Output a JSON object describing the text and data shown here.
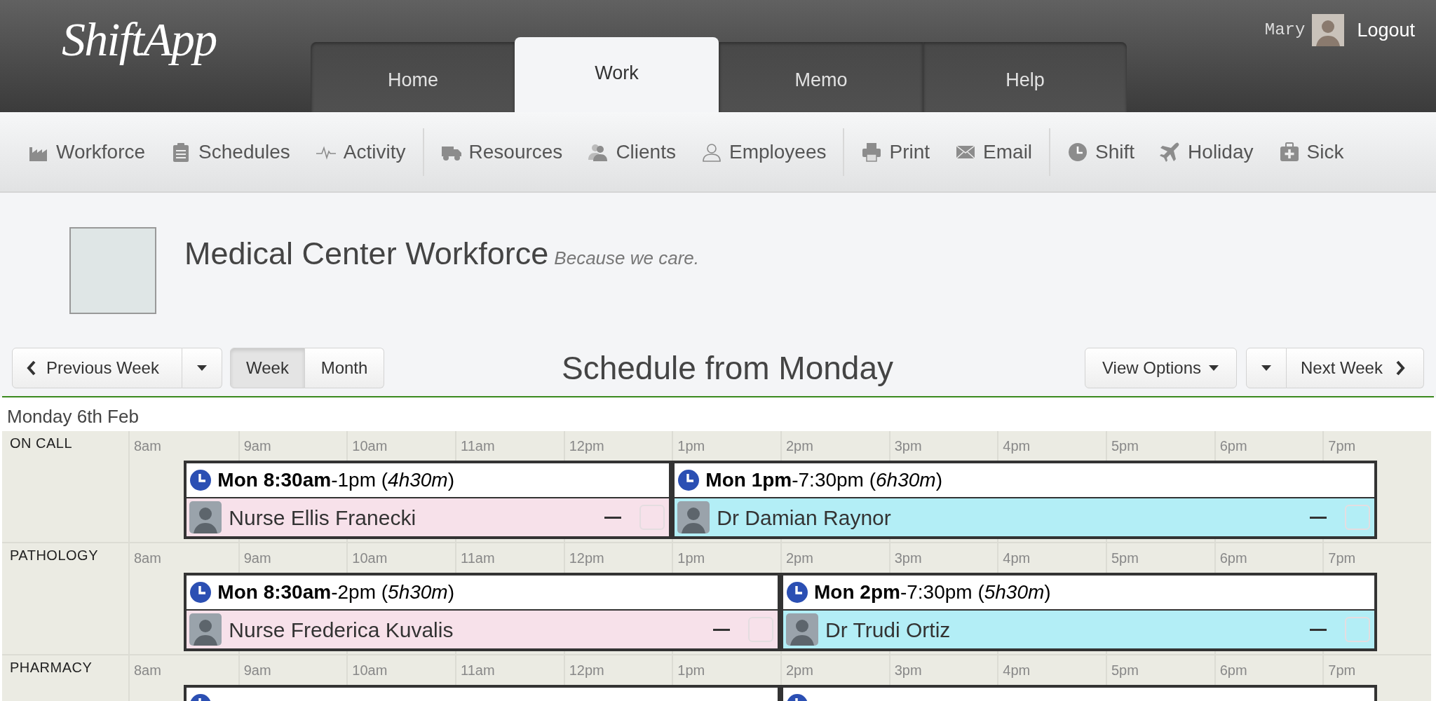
{
  "app": {
    "logo": "ShiftApp"
  },
  "nav_tabs": [
    {
      "label": "Home",
      "selected": false
    },
    {
      "label": "Work",
      "selected": true
    },
    {
      "label": "Memo",
      "selected": false
    },
    {
      "label": "Help",
      "selected": false
    }
  ],
  "user": {
    "name": "Mary",
    "logout": "Logout"
  },
  "toolbar": {
    "groups": [
      [
        {
          "label": "Workforce"
        },
        {
          "label": "Schedules"
        },
        {
          "label": "Activity"
        }
      ],
      [
        {
          "label": "Resources"
        },
        {
          "label": "Clients"
        },
        {
          "label": "Employees"
        }
      ],
      [
        {
          "label": "Print"
        },
        {
          "label": "Email"
        }
      ],
      [
        {
          "label": "Shift"
        },
        {
          "label": "Holiday"
        },
        {
          "label": "Sick"
        }
      ]
    ]
  },
  "organization": {
    "title": "Medical Center Workforce",
    "tagline": "Because we care."
  },
  "schedule_nav": {
    "previous": "Previous Week",
    "views": [
      {
        "label": "Week",
        "selected": true
      },
      {
        "label": "Month",
        "selected": false
      }
    ],
    "title": "Schedule from Monday",
    "view_options": "View Options",
    "next": "Next Week"
  },
  "day": {
    "label": "Monday 6th Feb",
    "lanes": [
      {
        "name": "ON CALL",
        "hours": [
          "8am",
          "9am",
          "10am",
          "11am",
          "12pm",
          "1pm",
          "2pm",
          "3pm",
          "4pm",
          "5pm",
          "6pm",
          "7pm"
        ],
        "shifts": [
          {
            "kind": "shift",
            "time": "**Mon 8:30am**-1pm (*4h30m*)",
            "employee": "Nurse Ellis Franecki",
            "color": "#f7e1ea",
            "checked": false
          },
          {
            "kind": "shift",
            "time": "**Mon 1pm**-7:30pm (*6h30m*)",
            "employee": "Dr Damian Raynor",
            "color": "#b3eef6",
            "checked": false
          }
        ]
      },
      {
        "name": "PATHOLOGY",
        "hours": [
          "8am",
          "9am",
          "10am",
          "11am",
          "12pm",
          "1pm",
          "2pm",
          "3pm",
          "4pm",
          "5pm",
          "6pm",
          "7pm"
        ],
        "shifts": [
          {
            "kind": "shift",
            "time": "**Mon 8:30am**-2pm (*5h30m*)",
            "employee": "Nurse Frederica Kuvalis",
            "color": "#f7e1ea",
            "checked": false
          },
          {
            "kind": "shift",
            "time": "**Mon 2pm**-7:30pm (*5h30m*)",
            "employee": "Dr Trudi Ortiz",
            "color": "#b3eef6",
            "checked": false
          }
        ]
      },
      {
        "name": "PHARMACY",
        "hours": [
          "8am",
          "9am",
          "10am",
          "11am",
          "12pm",
          "1pm",
          "2pm",
          "3pm",
          "4pm",
          "5pm",
          "6pm",
          "7pm"
        ],
        "shifts": [
          {
            "kind": "shift"
          },
          {
            "kind": "shift"
          }
        ]
      }
    ]
  }
}
